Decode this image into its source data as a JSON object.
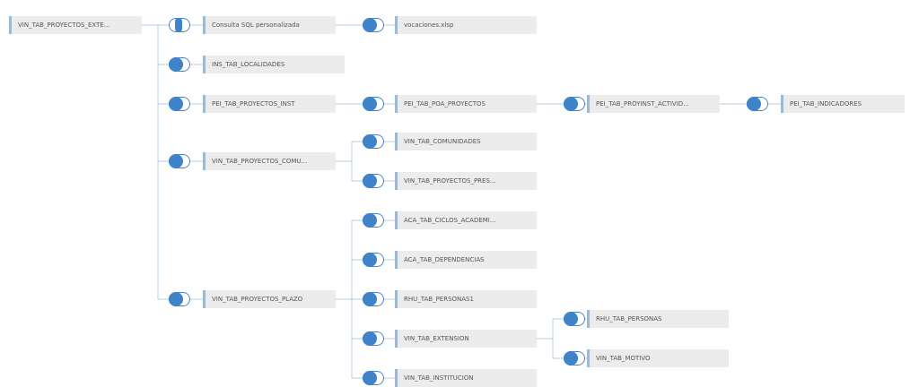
{
  "diagram": {
    "edge_color": "#b9cde0",
    "join_color": "#3f83c8",
    "nodes": [
      {
        "id": "root",
        "label": "VIN_TAB_PROYECTOS_EXTE..."
      },
      {
        "id": "sql",
        "label": "Consulta SQL personalizada"
      },
      {
        "id": "vocaciones",
        "label": "vocaciones.xlsp"
      },
      {
        "id": "localidades",
        "label": "INS_TAB_LOCALIDADES"
      },
      {
        "id": "pei_proyectos",
        "label": "PEI_TAB_PROYECTOS_INST"
      },
      {
        "id": "pei_poa",
        "label": "PEI_TAB_POA_PROYECTOS"
      },
      {
        "id": "pei_proyinst",
        "label": "PEI_TAB_PROYINST_ACTIVID..."
      },
      {
        "id": "pei_indicadores",
        "label": "PEI_TAB_INDICADORES"
      },
      {
        "id": "vin_comu",
        "label": "VIN_TAB_PROYECTOS_COMU..."
      },
      {
        "id": "vin_comunidades",
        "label": "VIN_TAB_COMUNIDADES"
      },
      {
        "id": "vin_proy_pres",
        "label": "VIN_TAB_PROYECTOS_PRES..."
      },
      {
        "id": "vin_plazo",
        "label": "VIN_TAB_PROYECTOS_PLAZO"
      },
      {
        "id": "aca_ciclos",
        "label": "ACA_TAB_CICLOS_ACADEMI..."
      },
      {
        "id": "aca_dependencias",
        "label": "ACA_TAB_DEPENDENCIAS"
      },
      {
        "id": "rhu_personas1",
        "label": "RHU_TAB_PERSONAS1"
      },
      {
        "id": "vin_extension",
        "label": "VIN_TAB_EXTENSION"
      },
      {
        "id": "vin_institucion",
        "label": "VIN_TAB_INSTITUCION"
      },
      {
        "id": "rhu_personas",
        "label": "RHU_TAB_PERSONAS"
      },
      {
        "id": "vin_motivo",
        "label": "VIN_TAB_MOTIVO"
      }
    ],
    "edges": [
      {
        "from": "root",
        "to": "sql",
        "join": "union-icon"
      },
      {
        "from": "sql",
        "to": "vocaciones",
        "join": "left-join-icon"
      },
      {
        "from": "root",
        "to": "localidades",
        "join": "left-join-icon"
      },
      {
        "from": "root",
        "to": "pei_proyectos",
        "join": "left-join-icon"
      },
      {
        "from": "pei_proyectos",
        "to": "pei_poa",
        "join": "inner-join-icon"
      },
      {
        "from": "pei_poa",
        "to": "pei_proyinst",
        "join": "inner-join-icon"
      },
      {
        "from": "pei_proyinst",
        "to": "pei_indicadores",
        "join": "left-join-icon"
      },
      {
        "from": "root",
        "to": "vin_comu",
        "join": "left-join-icon"
      },
      {
        "from": "vin_comu",
        "to": "vin_comunidades",
        "join": "left-join-icon"
      },
      {
        "from": "vin_comu",
        "to": "vin_proy_pres",
        "join": "left-join-icon"
      },
      {
        "from": "root",
        "to": "vin_plazo",
        "join": "left-join-icon"
      },
      {
        "from": "vin_plazo",
        "to": "aca_ciclos",
        "join": "left-join-icon"
      },
      {
        "from": "vin_plazo",
        "to": "aca_dependencias",
        "join": "left-join-icon"
      },
      {
        "from": "vin_plazo",
        "to": "rhu_personas1",
        "join": "left-join-icon"
      },
      {
        "from": "vin_plazo",
        "to": "vin_extension",
        "join": "left-join-icon"
      },
      {
        "from": "vin_plazo",
        "to": "vin_institucion",
        "join": "left-join-icon"
      },
      {
        "from": "vin_extension",
        "to": "rhu_personas",
        "join": "left-join-icon"
      },
      {
        "from": "vin_extension",
        "to": "vin_motivo",
        "join": "left-join-icon"
      }
    ]
  }
}
